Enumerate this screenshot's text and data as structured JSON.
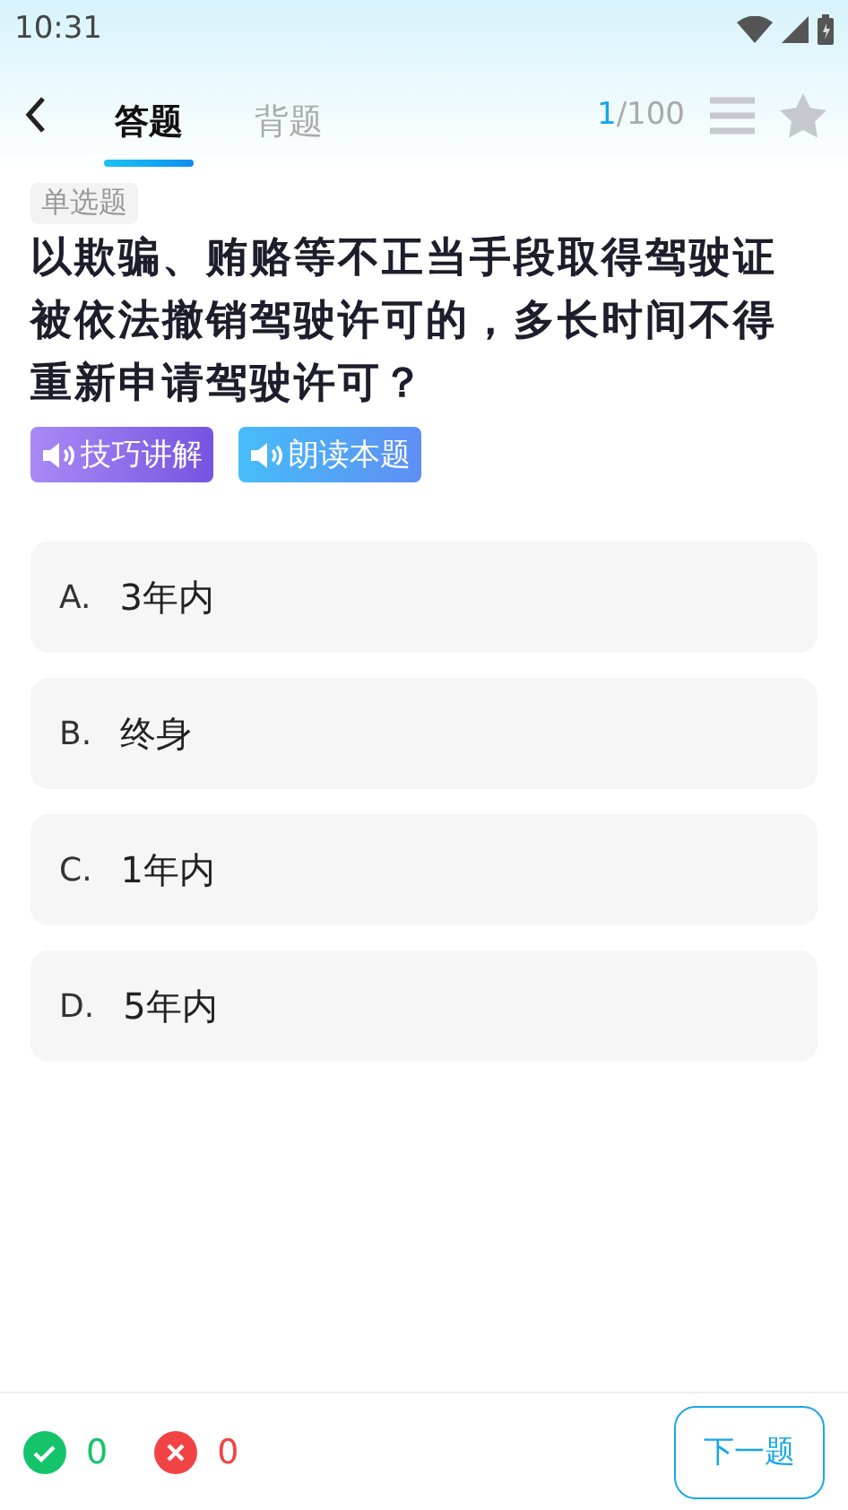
{
  "status_bar": {
    "time": "10:31"
  },
  "tabs": [
    {
      "label": "答题",
      "selected": true
    },
    {
      "label": "背题",
      "selected": false
    }
  ],
  "progress": {
    "current": "1",
    "total": "/100"
  },
  "question": {
    "type": "单选题",
    "text": "以欺骗、贿赂等不正当手段取得驾驶证被依法撤销驾驶许可的，多长时间不得重新申请驾驶许可？"
  },
  "audio_buttons": [
    {
      "label": "技巧讲解",
      "kind": "tips"
    },
    {
      "label": "朗读本题",
      "kind": "read"
    }
  ],
  "options": [
    {
      "letter": "A.",
      "text": "3年内"
    },
    {
      "letter": "B.",
      "text": "终身"
    },
    {
      "letter": "C.",
      "text": "1年内"
    },
    {
      "letter": "D.",
      "text": "5年内"
    }
  ],
  "footer": {
    "correct": "0",
    "wrong": "0",
    "next_button": "下一题"
  }
}
